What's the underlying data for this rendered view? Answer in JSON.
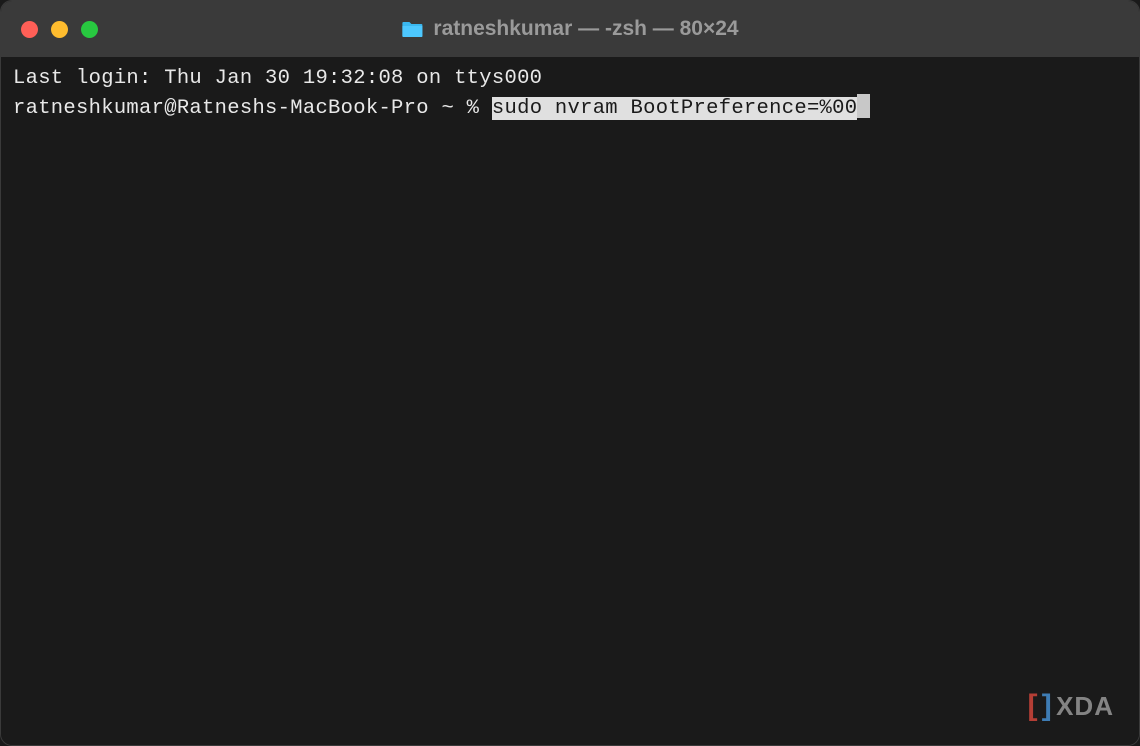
{
  "titlebar": {
    "title": "ratneshkumar — -zsh — 80×24"
  },
  "terminal": {
    "last_login": "Last login: Thu Jan 30 19:32:08 on ttys000",
    "prompt": "ratneshkumar@Ratneshs-MacBook-Pro ~ % ",
    "command": "sudo nvram BootPreference=%00"
  },
  "watermark": {
    "text": "XDA"
  },
  "colors": {
    "traffic_red": "#ff5f57",
    "traffic_yellow": "#febc2e",
    "traffic_green": "#28c840",
    "bg": "#1a1a1a",
    "titlebar_bg": "#3a3a3a",
    "text": "#e8e8e8",
    "highlight_bg": "#e0e0e0",
    "highlight_fg": "#1a1a1a"
  }
}
